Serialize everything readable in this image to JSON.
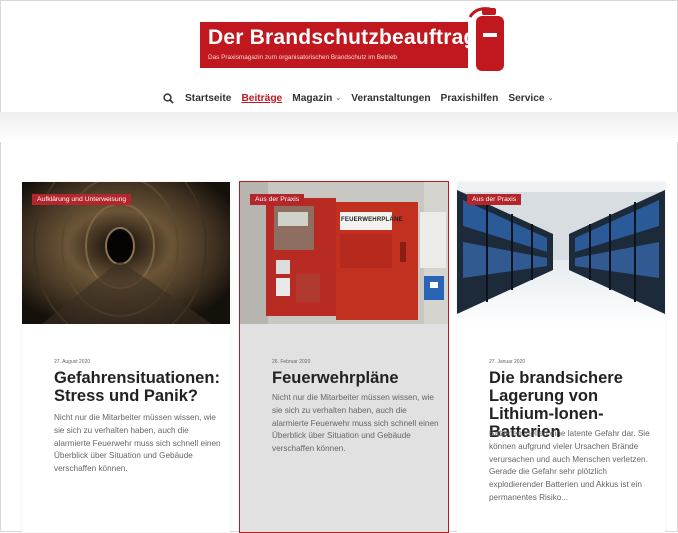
{
  "header": {
    "logo_title": "Der Brandschutzbeauftragte",
    "logo_subtitle": "Das Praxismagazin zum organisatorischen Brandschutz im Betrieb"
  },
  "nav": {
    "items": [
      {
        "label": "Startseite",
        "active": false,
        "dropdown": false
      },
      {
        "label": "Beiträge",
        "active": true,
        "dropdown": false
      },
      {
        "label": "Magazin",
        "active": false,
        "dropdown": true
      },
      {
        "label": "Veranstaltungen",
        "active": false,
        "dropdown": false
      },
      {
        "label": "Praxishilfen",
        "active": false,
        "dropdown": false
      },
      {
        "label": "Service",
        "active": false,
        "dropdown": true
      }
    ],
    "caret": "⌄"
  },
  "articles": [
    {
      "tag": "Aufklärung und Unterweisung",
      "date": "27. August 2020",
      "title": "Gefahrensituationen: Stress und Panik?",
      "excerpt": "Nicht nur die Mitarbeiter müssen wissen, wie sie sich zu verhalten haben, auch die alarmierte Feuerwehr muss sich schnell einen Überblick über Situation und Gebäude verschaffen können."
    },
    {
      "tag": "Aus der Praxis",
      "date": "26. Februar 2020",
      "title": "Feuerwehrpläne",
      "excerpt": "Nicht nur die Mitarbeiter müssen wissen, wie sie sich zu verhalten haben, auch die alarmierte Feuerwehr muss sich schnell einen Überblick über Situation und Gebäude verschaffen können.",
      "image_sign": "FEUERWEHRPLÄNE"
    },
    {
      "tag": "Aus der Praxis",
      "date": "27. Januar 2020",
      "title": "Die brandsichere Lagerung von Lithium-Ionen-Batterien",
      "excerpt": "Batterien stellen eine latente Gefahr dar. Sie können aufgrund vieler Ursachen Brände verursachen und auch Menschen verletzen. Gerade die Gefahr sehr plötzlich explodierender Batterien und Akkus ist ein permanentes Risiko..."
    }
  ],
  "colors": {
    "brand_red": "#c0181e",
    "tag_red": "#b3262b"
  }
}
